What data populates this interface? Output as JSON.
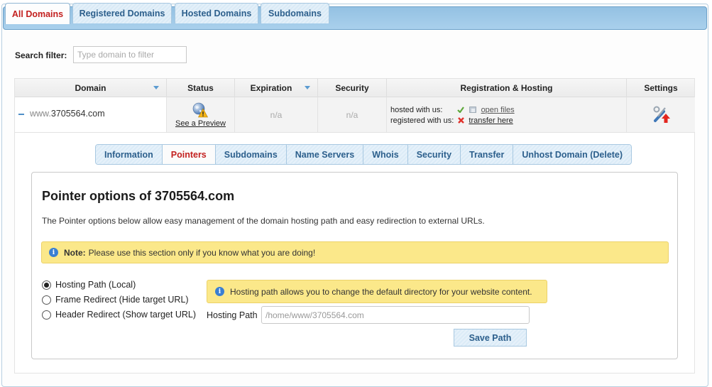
{
  "top_tabs": [
    {
      "label": "All Domains",
      "active": true
    },
    {
      "label": "Registered Domains",
      "active": false
    },
    {
      "label": "Hosted Domains",
      "active": false
    },
    {
      "label": "Subdomains",
      "active": false
    }
  ],
  "search": {
    "label": "Search filter:",
    "placeholder": "Type domain to filter",
    "value": ""
  },
  "table": {
    "columns": [
      {
        "label": "Domain",
        "sortable": true
      },
      {
        "label": "Status",
        "sortable": false
      },
      {
        "label": "Expiration",
        "sortable": true
      },
      {
        "label": "Security",
        "sortable": false
      },
      {
        "label": "Registration & Hosting",
        "sortable": false
      },
      {
        "label": "Settings",
        "sortable": false
      }
    ],
    "rows": [
      {
        "domain_prefix": "www.",
        "domain": "3705564.com",
        "status_icon": "globe-warning-icon",
        "status_link": "See a Preview",
        "expiration": "n/a",
        "security": "n/a",
        "hosted_label": "hosted with us:",
        "hosted_status": "check-icon",
        "hosted_link": "open files",
        "registered_label": "registered with us:",
        "registered_status": "cross-icon",
        "registered_link": "transfer here",
        "settings_icon": "tools-icon"
      }
    ]
  },
  "sub_tabs": [
    {
      "label": "Information",
      "active": false
    },
    {
      "label": "Pointers",
      "active": true
    },
    {
      "label": "Subdomains",
      "active": false
    },
    {
      "label": "Name Servers",
      "active": false
    },
    {
      "label": "Whois",
      "active": false
    },
    {
      "label": "Security",
      "active": false
    },
    {
      "label": "Transfer",
      "active": false
    },
    {
      "label": "Unhost Domain (Delete)",
      "active": false
    }
  ],
  "panel": {
    "title": "Pointer options of 3705564.com",
    "description": "The Pointer options below allow easy management of the domain hosting path and easy redirection to external URLs.",
    "note_label": "Note:",
    "note_text": "Please use this section only if you know what you are doing!",
    "options": [
      {
        "label": "Hosting Path (Local)",
        "checked": true
      },
      {
        "label": "Frame Redirect (Hide target URL)",
        "checked": false
      },
      {
        "label": "Header Redirect (Show target URL)",
        "checked": false
      }
    ],
    "hint": "Hosting path allows you to change the default directory for your website content.",
    "path_label": "Hosting Path",
    "path_placeholder": "/home/www/3705564.com",
    "save_label": "Save Path"
  },
  "colors": {
    "accent_active": "#c3201f",
    "tab_text": "#2c5f8c",
    "note_bg": "#fbe88a",
    "info_blue": "#3a7fd2"
  }
}
